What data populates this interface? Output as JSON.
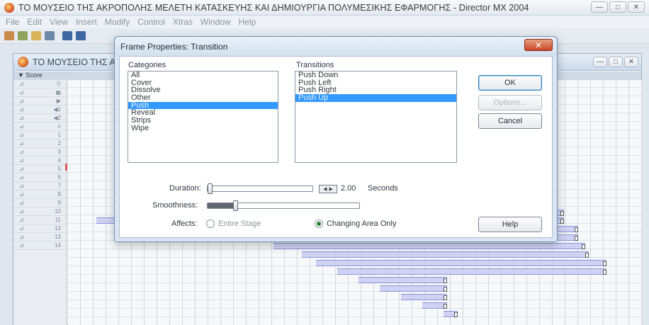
{
  "window": {
    "title": "ΤΟ ΜΟΥΣΕΙΟ ΤΗΣ ΑΚΡΟΠΟΛΗΣ ΜΕΛΕΤΗ ΚΑΤΑΣΚΕΥΗΣ ΚΑΙ ΔΗΜΙΟΥΡΓΙΑ ΠΟΛΥΜΕΣΙΚΗΣ ΕΦΑΡΜΟΓΗΣ - Director MX 2004",
    "min_glyph": "—",
    "max_glyph": "□",
    "close_glyph": "✕"
  },
  "menu": [
    "File",
    "Edit",
    "View",
    "Insert",
    "Modify",
    "Control",
    "Xtras",
    "Window",
    "Help"
  ],
  "score_window": {
    "title": "ΤΟ ΜΟΥΣΕΙΟ ΤΗΣ Α",
    "subtitle": "▼ Score",
    "channel_rows": 20
  },
  "dialog": {
    "title": "Frame Properties: Transition",
    "close_glyph": "✕",
    "categories_label": "Categories",
    "categories": [
      "All",
      "Cover",
      "Dissolve",
      "Other",
      "Push",
      "Reveal",
      "Strips",
      "Wipe"
    ],
    "categories_selected": "Push",
    "transitions_label": "Transitions",
    "transitions": [
      "Push Down",
      "Push Left",
      "Push Right",
      "Push Up"
    ],
    "transitions_selected": "Push Up",
    "ok_label": "OK",
    "options_label": "Options...",
    "cancel_label": "Cancel",
    "help_label": "Help",
    "duration_label": "Duration:",
    "duration_value": "2.00",
    "duration_unit": "Seconds",
    "duration_fraction": 0.02,
    "smoothness_label": "Smoothness:",
    "smoothness_fraction": 0.18,
    "affects_label": "Affects:",
    "affects_options": [
      "Entire Stage",
      "Changing Area Only"
    ],
    "affects_selected": "Changing Area Only"
  }
}
